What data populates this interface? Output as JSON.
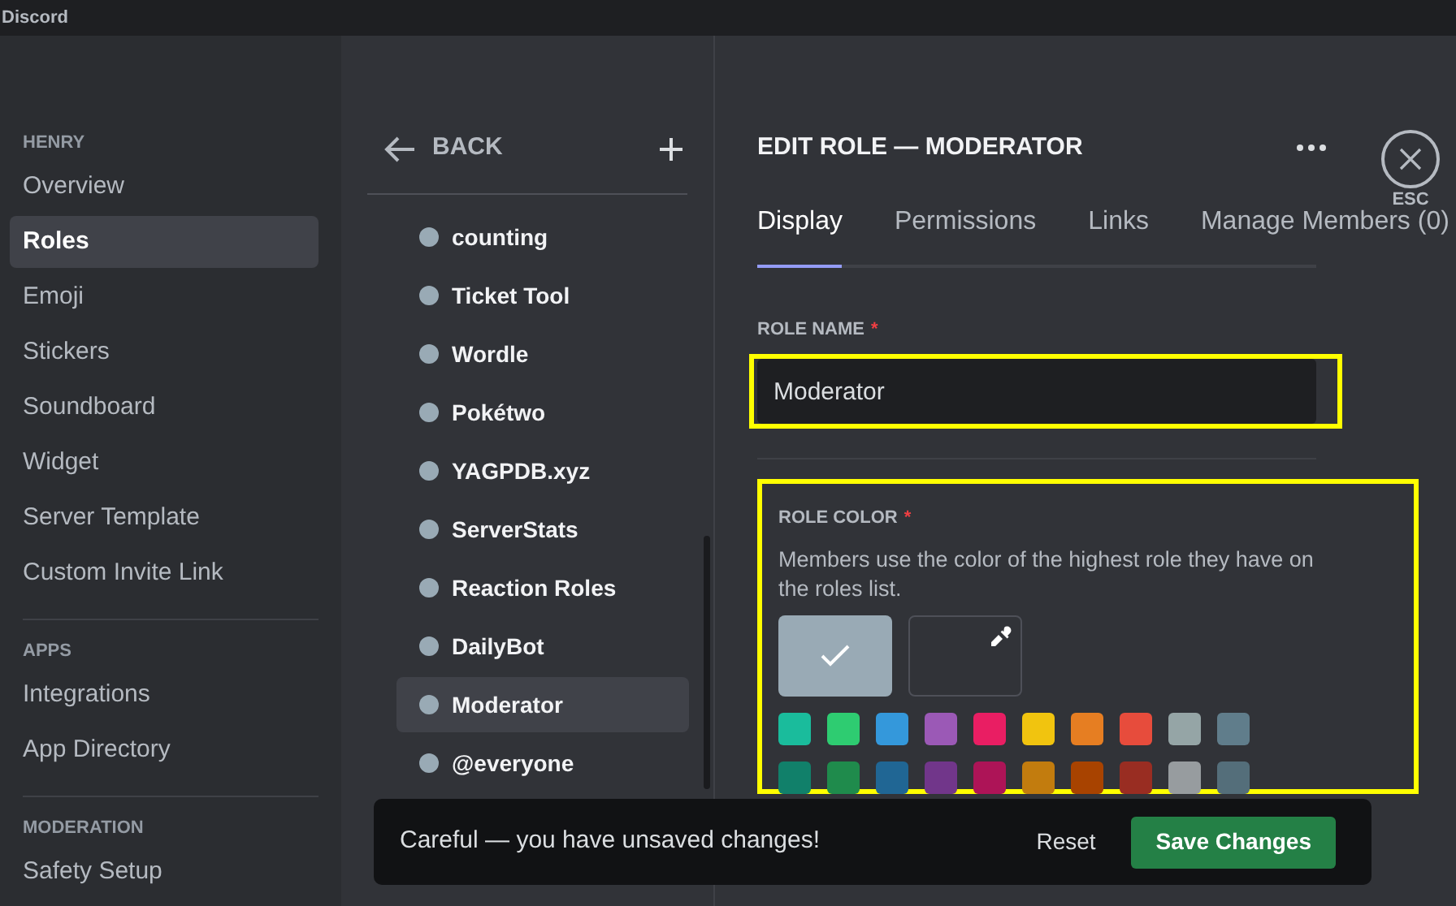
{
  "window": {
    "title": "Discord"
  },
  "sidebar": {
    "sections": [
      {
        "heading": "HENRY",
        "items": [
          {
            "label": "Overview",
            "selected": false
          },
          {
            "label": "Roles",
            "selected": true
          },
          {
            "label": "Emoji",
            "selected": false
          },
          {
            "label": "Stickers",
            "selected": false
          },
          {
            "label": "Soundboard",
            "selected": false
          },
          {
            "label": "Widget",
            "selected": false
          },
          {
            "label": "Server Template",
            "selected": false
          },
          {
            "label": "Custom Invite Link",
            "selected": false
          }
        ]
      },
      {
        "heading": "APPS",
        "items": [
          {
            "label": "Integrations",
            "selected": false
          },
          {
            "label": "App Directory",
            "selected": false
          }
        ]
      },
      {
        "heading": "MODERATION",
        "items": [
          {
            "label": "Safety Setup",
            "selected": false
          }
        ]
      }
    ]
  },
  "roles_panel": {
    "back_label": "BACK",
    "roles": [
      {
        "name": "counting",
        "selected": false,
        "color": "#99aab5"
      },
      {
        "name": "Ticket Tool",
        "selected": false,
        "color": "#99aab5"
      },
      {
        "name": "Wordle",
        "selected": false,
        "color": "#99aab5"
      },
      {
        "name": "Pokétwo",
        "selected": false,
        "color": "#99aab5"
      },
      {
        "name": "YAGPDB.xyz",
        "selected": false,
        "color": "#99aab5"
      },
      {
        "name": "ServerStats",
        "selected": false,
        "color": "#99aab5"
      },
      {
        "name": "Reaction Roles",
        "selected": false,
        "color": "#99aab5"
      },
      {
        "name": "DailyBot",
        "selected": false,
        "color": "#99aab5"
      },
      {
        "name": "Moderator",
        "selected": true,
        "color": "#99aab5"
      },
      {
        "name": "@everyone",
        "selected": false,
        "color": "#99aab5"
      }
    ]
  },
  "editor": {
    "title": "EDIT ROLE — MODERATOR",
    "close_label": "ESC",
    "tabs": [
      {
        "label": "Display",
        "selected": true
      },
      {
        "label": "Permissions",
        "selected": false
      },
      {
        "label": "Links",
        "selected": false
      },
      {
        "label": "Manage Members (0)",
        "selected": false
      }
    ],
    "role_name": {
      "label": "ROLE NAME",
      "required_mark": "*",
      "value": "Moderator"
    },
    "role_color": {
      "label": "ROLE COLOR",
      "required_mark": "*",
      "description": "Members use the color of the highest role they have on the roles list.",
      "default_swatch": {
        "color": "#99aab5",
        "selected": true
      },
      "swatches": [
        {
          "color": "#1abc9c",
          "selected": false
        },
        {
          "color": "#2ecc71",
          "selected": false
        },
        {
          "color": "#3498db",
          "selected": false
        },
        {
          "color": "#9b59b6",
          "selected": false
        },
        {
          "color": "#e91e63",
          "selected": false
        },
        {
          "color": "#f1c40f",
          "selected": false
        },
        {
          "color": "#e67e22",
          "selected": false
        },
        {
          "color": "#e74c3c",
          "selected": false
        },
        {
          "color": "#95a5a6",
          "selected": false
        },
        {
          "color": "#607d8b",
          "selected": false
        },
        {
          "color": "#11806a",
          "selected": false
        },
        {
          "color": "#1f8b4c",
          "selected": false
        },
        {
          "color": "#206694",
          "selected": false
        },
        {
          "color": "#71368a",
          "selected": false
        },
        {
          "color": "#ad1457",
          "selected": false
        },
        {
          "color": "#c27c0e",
          "selected": false
        },
        {
          "color": "#a84300",
          "selected": false
        },
        {
          "color": "#992d22",
          "selected": false
        },
        {
          "color": "#979c9f",
          "selected": false
        },
        {
          "color": "#546e7a",
          "selected": false
        }
      ]
    }
  },
  "toast": {
    "message": "Careful — you have unsaved changes!",
    "reset_label": "Reset",
    "save_label": "Save Changes"
  }
}
